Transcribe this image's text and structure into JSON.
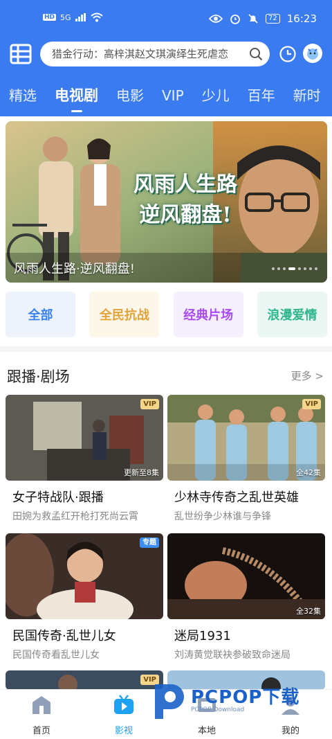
{
  "status_bar": {
    "left_chip": "HD",
    "signal": "5G",
    "battery": "72",
    "time": "16:23"
  },
  "search": {
    "placeholder": "猎金行动：高梓淇赵文琪演绎生死虐恋"
  },
  "tabs": [
    {
      "label": "精选",
      "active": false
    },
    {
      "label": "电视剧",
      "active": true
    },
    {
      "label": "电影",
      "active": false
    },
    {
      "label": "VIP",
      "active": false
    },
    {
      "label": "少儿",
      "active": false
    },
    {
      "label": "百年",
      "active": false
    },
    {
      "label": "新时",
      "active": false
    }
  ],
  "banner": {
    "art_title_line1": "风雨人生路",
    "art_title_line2": "逆风翻盘!",
    "caption": "风雨人生路·逆风翻盘!",
    "dot_count": 8,
    "active_dot": 3
  },
  "categories": [
    {
      "label": "全部",
      "bg": "#eef3fb",
      "color": "#3b82f0"
    },
    {
      "label": "全民抗战",
      "bg": "#fdf7ea",
      "color": "#e3a23a"
    },
    {
      "label": "经典片场",
      "bg": "#f6effd",
      "color": "#a84cf0"
    },
    {
      "label": "浪漫爱情",
      "bg": "#eaf7f2",
      "color": "#2fb68c"
    }
  ],
  "section": {
    "title": "跟播·剧场",
    "more": "更多 >"
  },
  "cards": [
    {
      "title": "女子特战队·跟播",
      "subtitle": "田婉为救孟红开枪打死尚云霄",
      "tag": "VIP",
      "tag_type": "vip",
      "overlay": "更新至8集"
    },
    {
      "title": "少林寺传奇之乱世英雄",
      "subtitle": "乱世纷争少林谁与争锋",
      "tag": "VIP",
      "tag_type": "vip",
      "overlay": "全42集"
    },
    {
      "title": "民国传奇·乱世儿女",
      "subtitle": "民国传奇看乱世儿女",
      "tag": "专题",
      "tag_type": "topic",
      "overlay": ""
    },
    {
      "title": "迷局1931",
      "subtitle": "刘涛黄觉联袂参破致命迷局",
      "tag": "",
      "tag_type": "",
      "overlay": "全32集"
    },
    {
      "title": "",
      "subtitle": "",
      "tag": "VIP",
      "tag_type": "vip",
      "overlay": ""
    }
  ],
  "bottom_nav": [
    {
      "label": "首页",
      "icon": "home-icon",
      "active": false
    },
    {
      "label": "影视",
      "icon": "tv-icon",
      "active": true
    },
    {
      "label": "本地",
      "icon": "location-icon",
      "active": false
    },
    {
      "label": "我的",
      "icon": "profile-icon",
      "active": false
    }
  ],
  "watermark": {
    "text": "PCPOP下载",
    "sub": "PCPOP Download"
  },
  "colors": {
    "primary": "#3b7bf0",
    "nav_active": "#1da1f2"
  }
}
